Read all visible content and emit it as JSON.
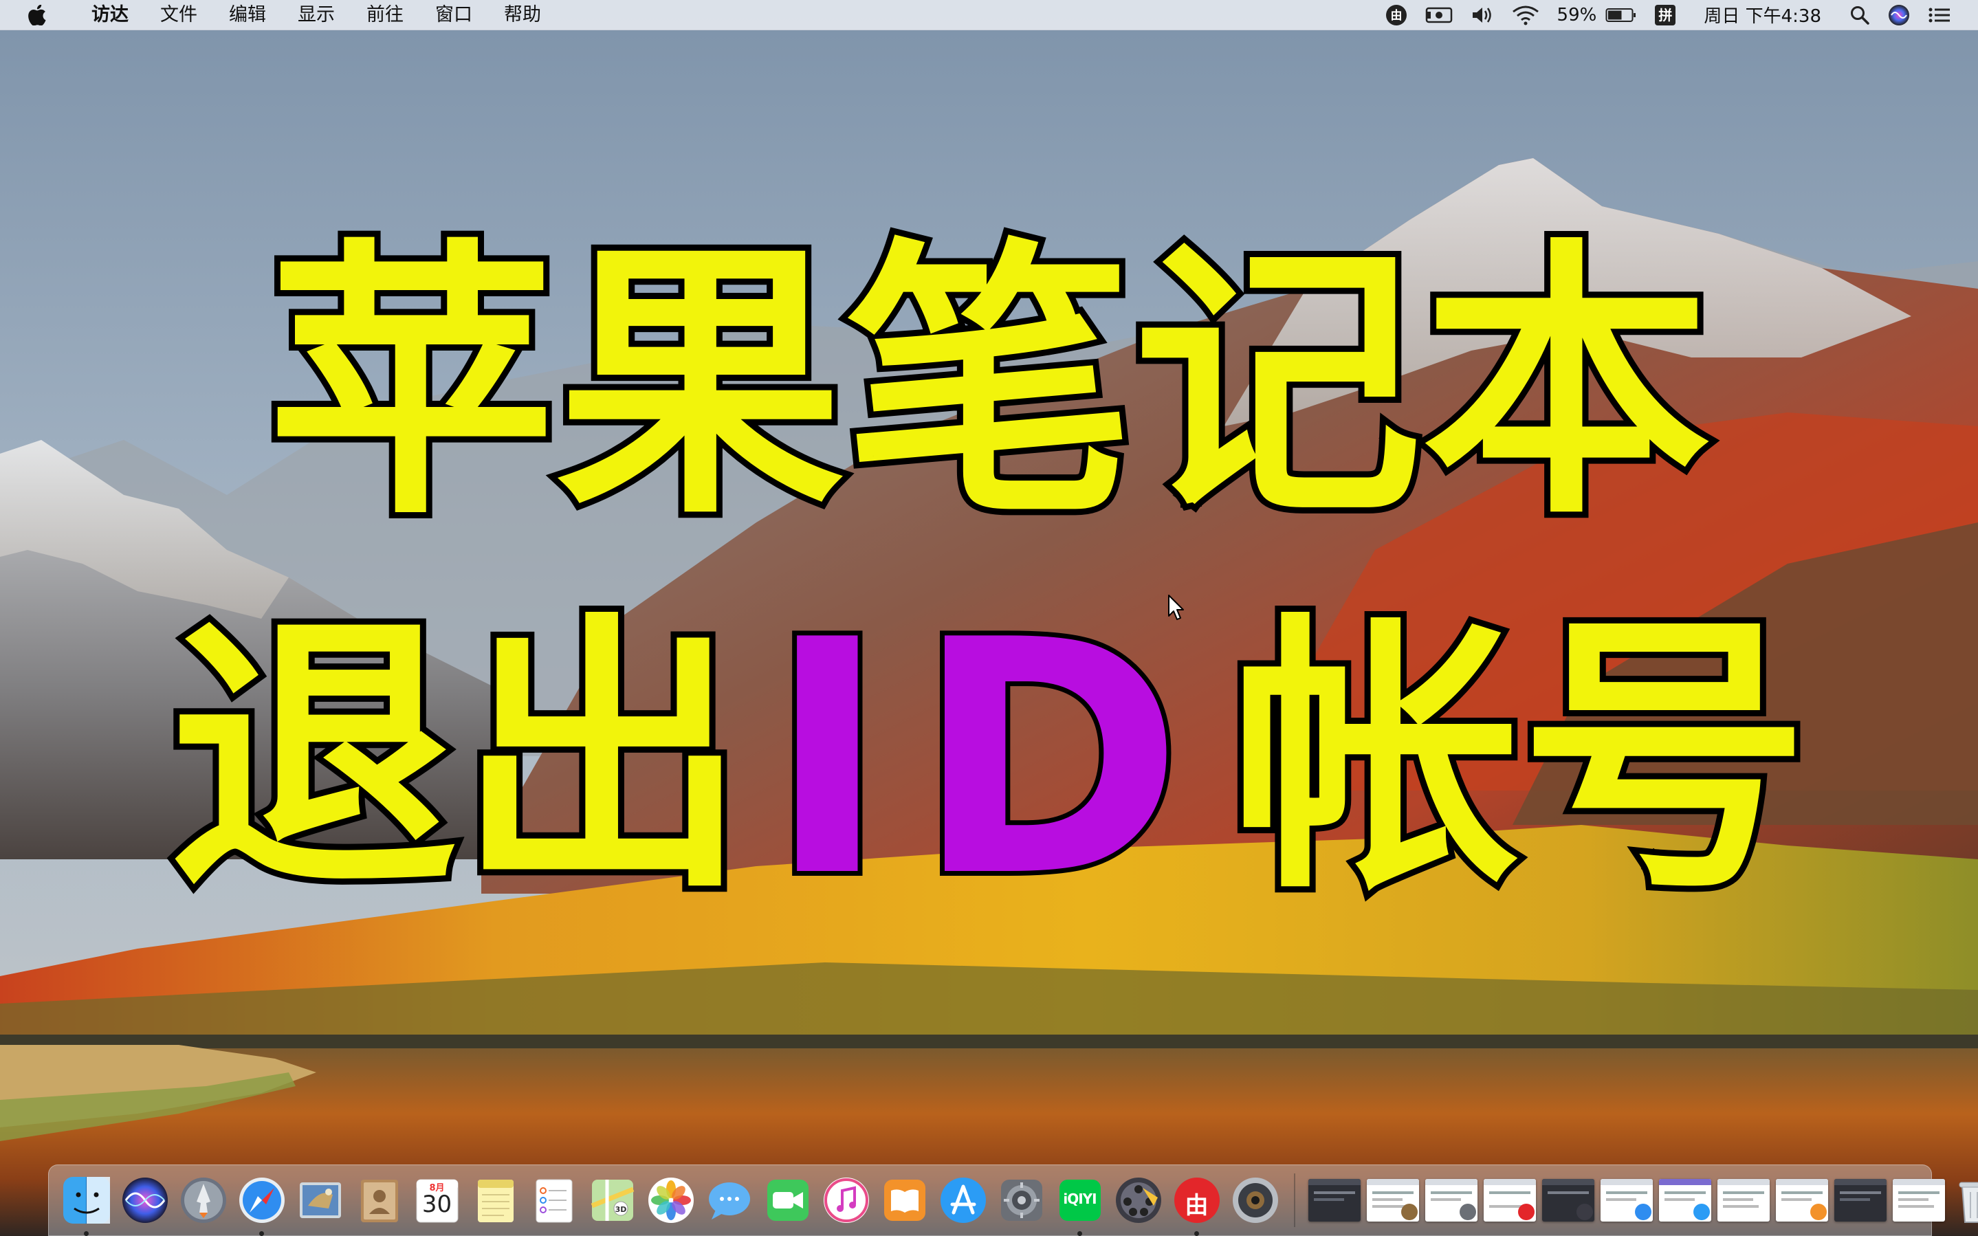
{
  "menubar": {
    "apple_icon": "apple-logo-icon",
    "app_name": "访达",
    "menus": [
      "文件",
      "编辑",
      "显示",
      "前往",
      "窗口",
      "帮助"
    ],
    "status": {
      "input_app_icon": "youdao-icon",
      "screen_record_icon": "camera-icon",
      "volume_icon": "speaker-icon",
      "wifi_icon": "wifi-icon",
      "battery_percent": "59%",
      "battery_level": 0.59,
      "input_method": "拼",
      "clock": "周日 下午4:38",
      "spotlight_icon": "search-icon",
      "siri_icon": "siri-icon",
      "notification_icon": "list-icon"
    }
  },
  "overlay": {
    "line1": "苹果笔记本",
    "line2_prefix": "退出",
    "line2_highlight": "ID",
    "line2_suffix": "帐号",
    "text_color": "#f2f40b",
    "highlight_color": "#b80de0"
  },
  "dock": {
    "apps": [
      {
        "name": "finder-icon",
        "running": true
      },
      {
        "name": "siri-icon",
        "running": false
      },
      {
        "name": "launchpad-icon",
        "running": false
      },
      {
        "name": "safari-icon",
        "running": true
      },
      {
        "name": "mail-icon",
        "running": false
      },
      {
        "name": "contacts-icon",
        "running": false
      },
      {
        "name": "calendar-icon",
        "running": false,
        "month": "8月",
        "day": "30"
      },
      {
        "name": "notes-icon",
        "running": false
      },
      {
        "name": "reminders-icon",
        "running": false
      },
      {
        "name": "maps-icon",
        "running": false
      },
      {
        "name": "photos-icon",
        "running": false
      },
      {
        "name": "messages-icon",
        "running": false
      },
      {
        "name": "facetime-icon",
        "running": false
      },
      {
        "name": "itunes-icon",
        "running": false
      },
      {
        "name": "ibooks-icon",
        "running": false
      },
      {
        "name": "app-store-icon",
        "running": false
      },
      {
        "name": "system-preferences-icon",
        "running": false
      },
      {
        "name": "iqiyi-icon",
        "running": true,
        "label": "iQIYI"
      },
      {
        "name": "video-editor-icon",
        "running": false
      },
      {
        "name": "youdao-dict-icon",
        "running": true,
        "label": "由"
      },
      {
        "name": "screen-recorder-icon",
        "running": false
      }
    ],
    "minimized_windows": [
      "window-thumb",
      "window-thumb",
      "window-thumb",
      "window-thumb",
      "window-thumb",
      "window-thumb",
      "window-thumb",
      "window-thumb",
      "window-thumb",
      "window-thumb"
    ],
    "trash_icon": "trash-icon"
  }
}
